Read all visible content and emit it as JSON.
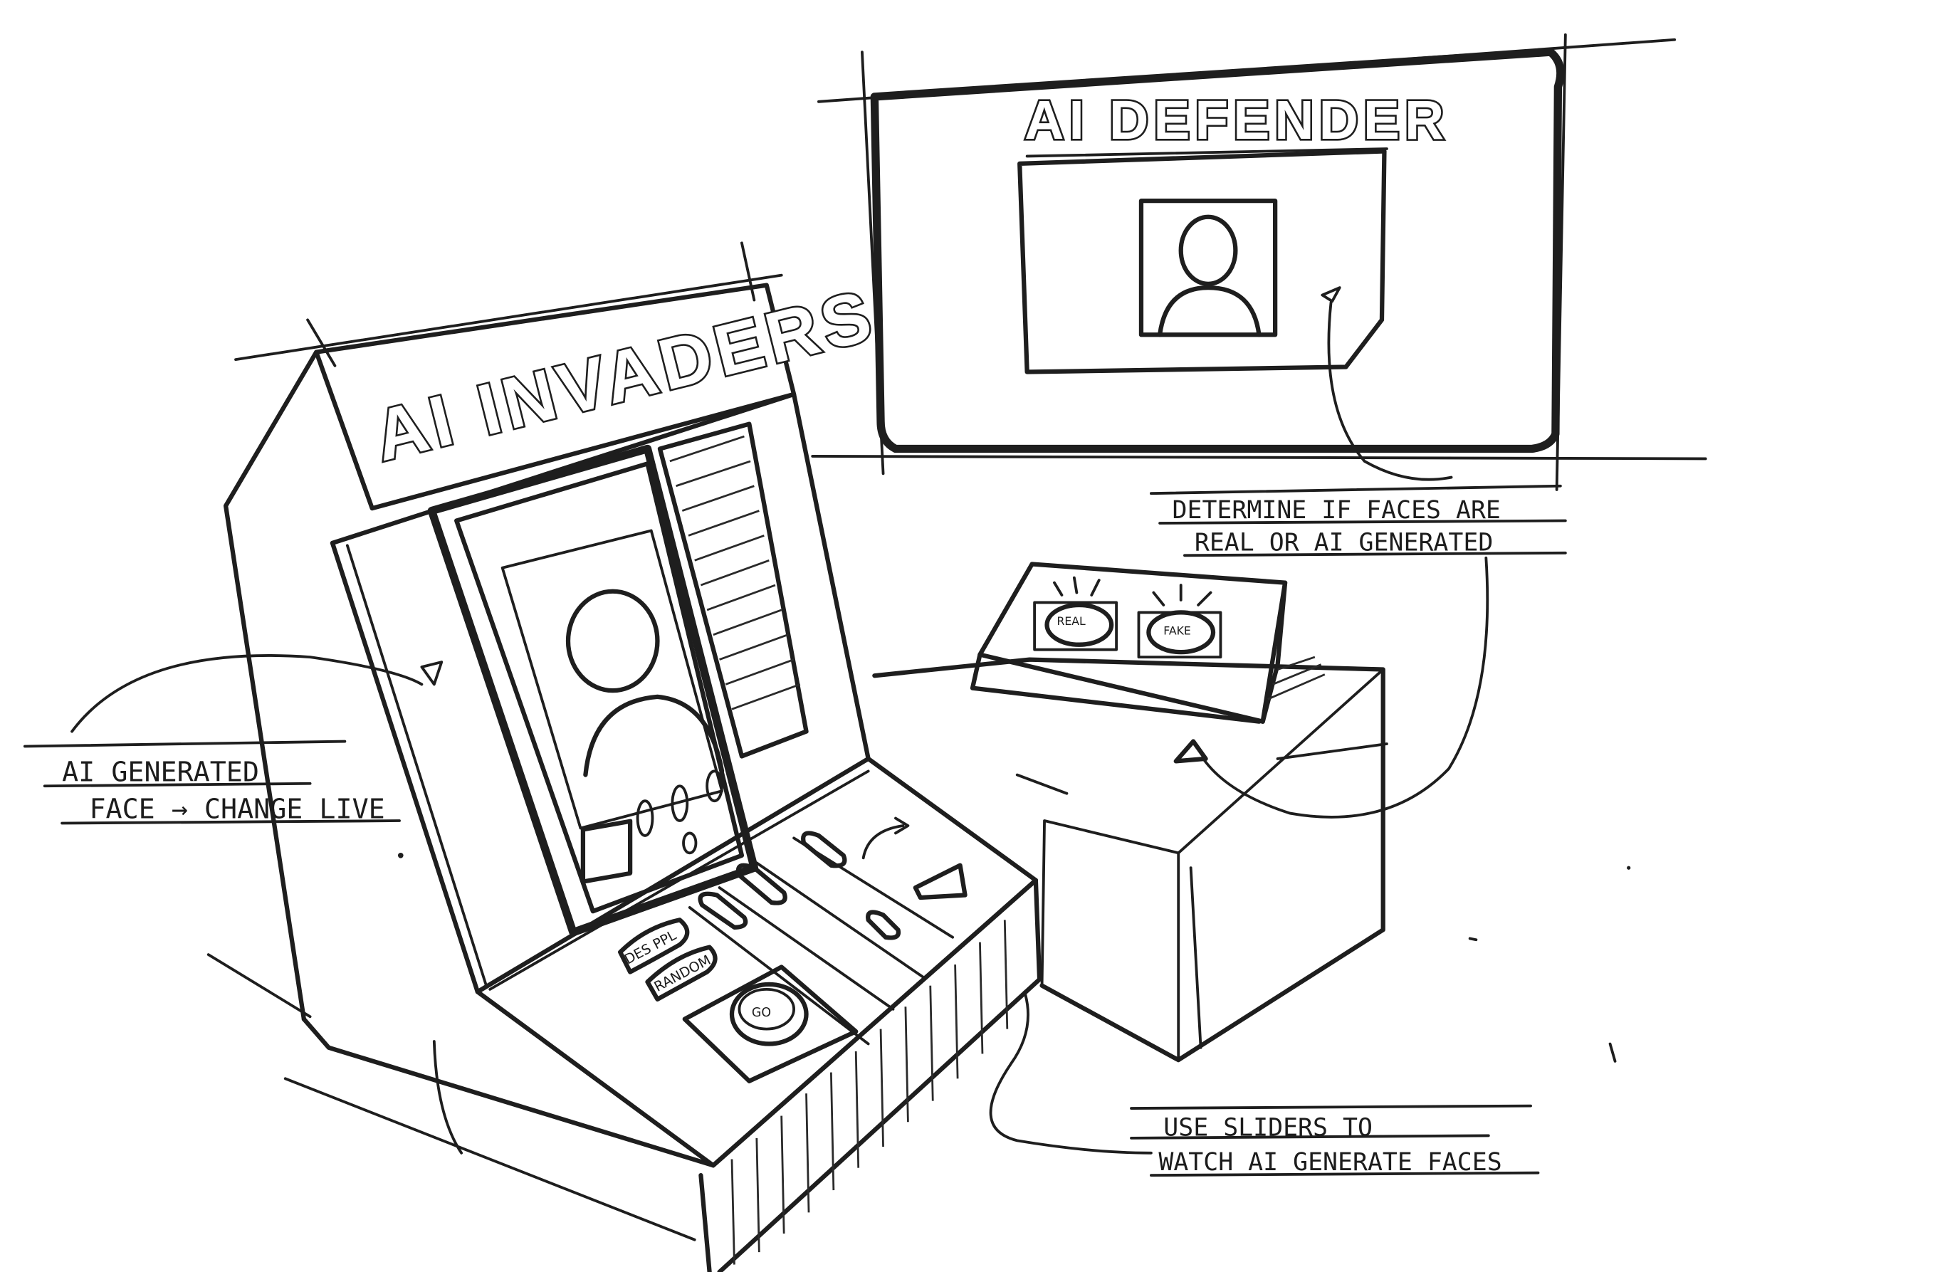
{
  "cabinet": {
    "marquee": "AI INVADERS",
    "buttons": {
      "des_ppl": "DES PPL",
      "random": "RANDOM",
      "go": "GO"
    }
  },
  "display": {
    "title": "AI DEFENDER"
  },
  "button_box": {
    "real": "REAL",
    "fake": "FAKE"
  },
  "annotations": {
    "face": {
      "line1": "AI GENERATED",
      "line2": "FACE → CHANGE LIVE"
    },
    "determine": {
      "line1": "DETERMINE IF FACES ARE",
      "line2": "REAL OR AI GENERATED"
    },
    "sliders": {
      "line1": "USE SLIDERS TO",
      "line2": "WATCH AI GENERATE FACES"
    }
  }
}
